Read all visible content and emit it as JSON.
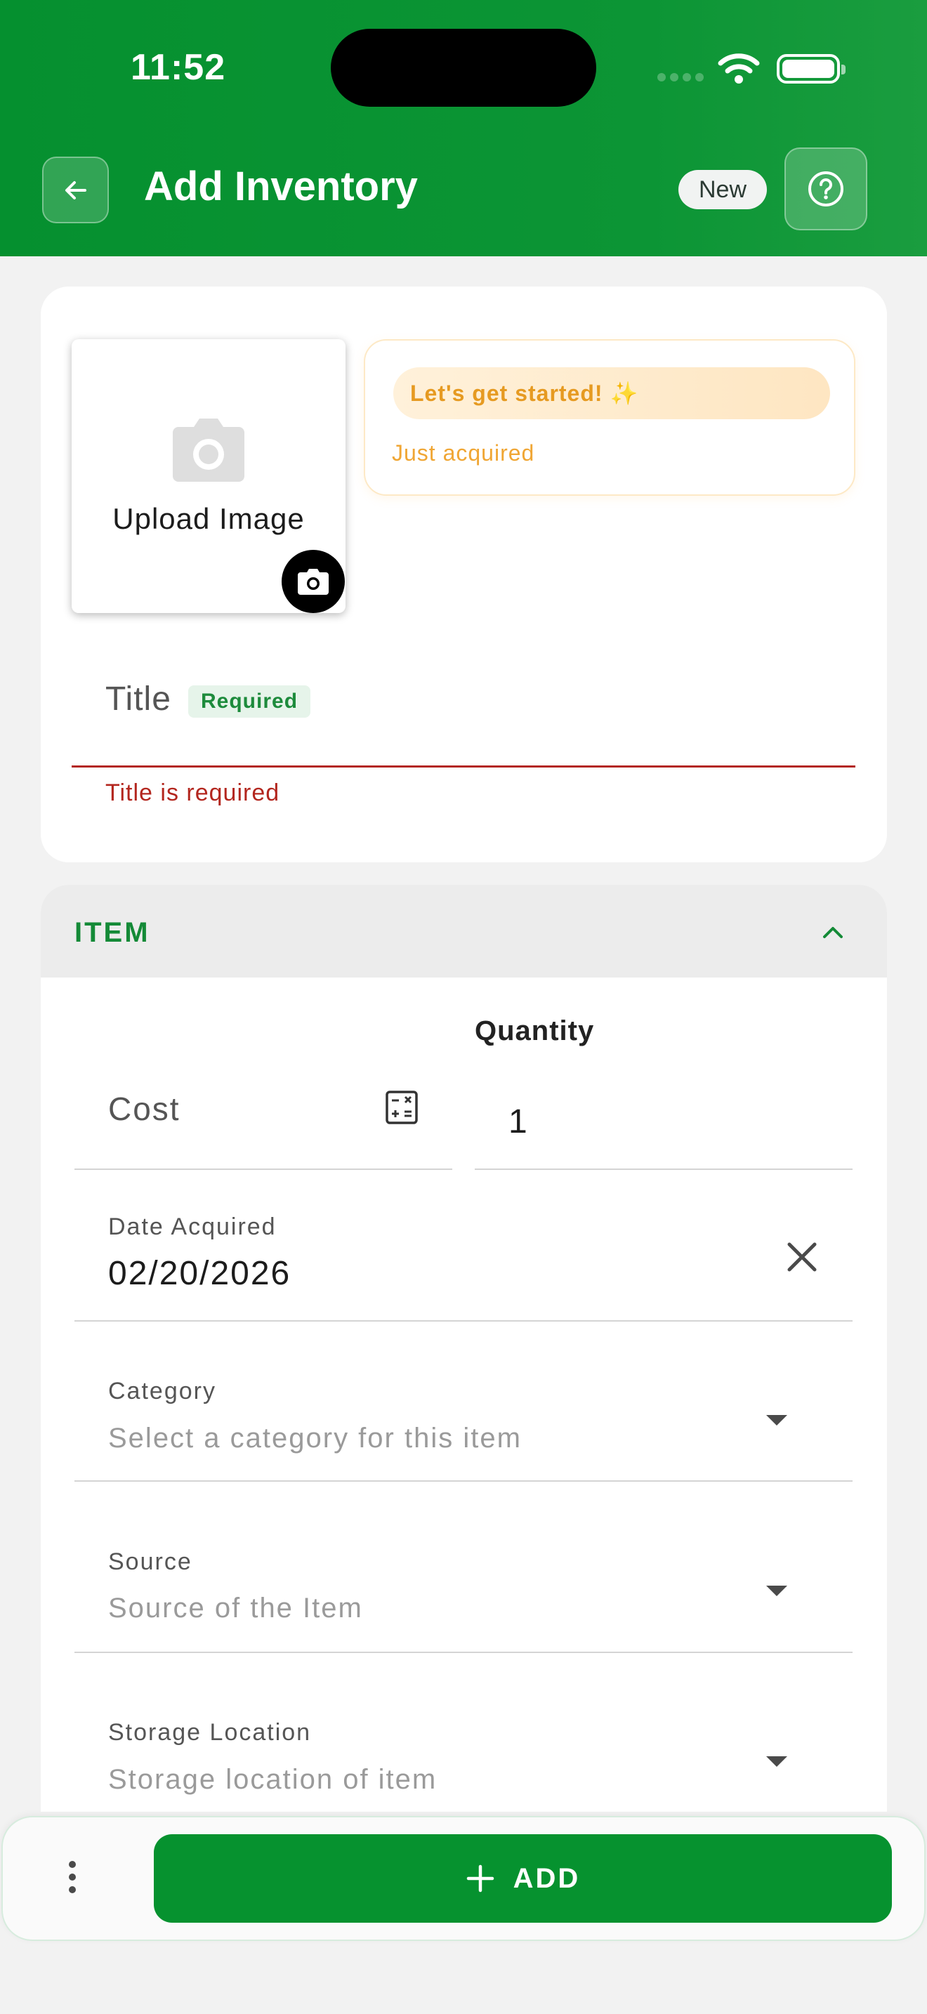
{
  "status_bar": {
    "time": "11:52"
  },
  "header": {
    "title": "Add Inventory",
    "badge": "New",
    "icons": {
      "back": "arrow-left-icon",
      "help": "help-circle-icon"
    }
  },
  "upload": {
    "label": "Upload Image",
    "icon": "camera-icon"
  },
  "started": {
    "title": "Let's get started! ✨",
    "subtitle": "Just acquired"
  },
  "title_field": {
    "label": "Title",
    "badge": "Required",
    "error": "Title is required"
  },
  "item_section": {
    "title": "ITEM",
    "collapse_icon": "chevron-up-icon",
    "cost": {
      "placeholder": "Cost",
      "icon": "calculator-icon"
    },
    "quantity": {
      "label": "Quantity",
      "value": "1"
    },
    "date_acquired": {
      "label": "Date Acquired",
      "value": "02/20/2026",
      "clear_icon": "close-icon"
    },
    "category": {
      "label": "Category",
      "placeholder": "Select a category for this item"
    },
    "source": {
      "label": "Source",
      "placeholder": "Source of the Item"
    },
    "storage_location": {
      "label": "Storage Location",
      "placeholder": "Storage location of item"
    }
  },
  "bottom_bar": {
    "more_icon": "more-vertical-icon",
    "add_label": "ADD",
    "add_icon": "plus-icon"
  },
  "colors": {
    "primary": "#06922F",
    "error": "#B3261E",
    "accent_orange": "#E69A21"
  }
}
